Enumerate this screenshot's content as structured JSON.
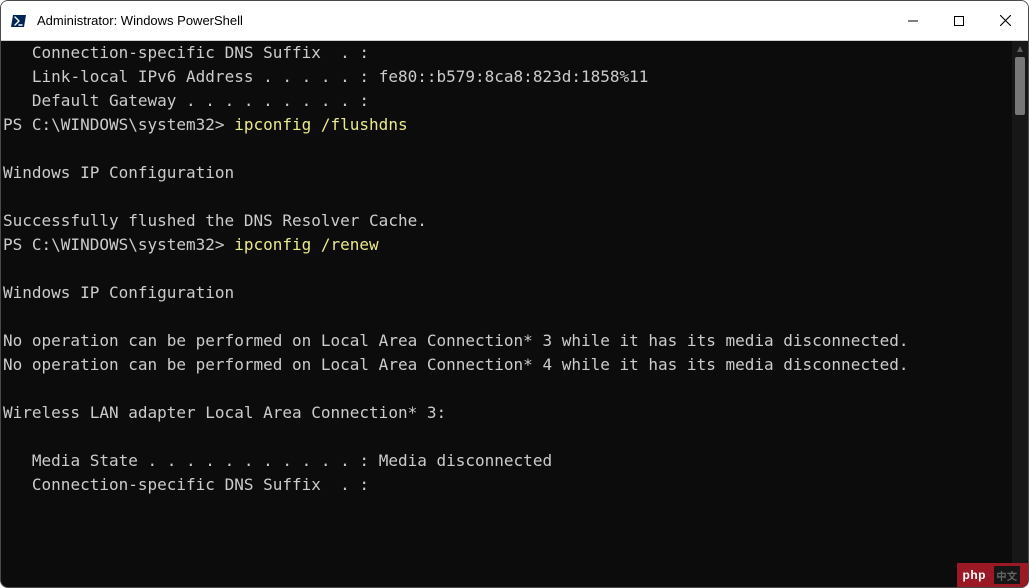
{
  "titlebar": {
    "title": "Administrator: Windows PowerShell"
  },
  "console": {
    "l01": "   Connection-specific DNS Suffix  . :",
    "l02": "   Link-local IPv6 Address . . . . . : fe80::b579:8ca8:823d:1858%11",
    "l03": "   Default Gateway . . . . . . . . . :",
    "p1_prompt": "PS C:\\WINDOWS\\system32> ",
    "p1_cmd": "ipconfig /flushdns",
    "l05": "",
    "l06": "Windows IP Configuration",
    "l07": "",
    "l08": "Successfully flushed the DNS Resolver Cache.",
    "p2_prompt": "PS C:\\WINDOWS\\system32> ",
    "p2_cmd": "ipconfig /renew",
    "l10": "",
    "l11": "Windows IP Configuration",
    "l12": "",
    "l13": "No operation can be performed on Local Area Connection* 3 while it has its media disconnected.",
    "l14": "No operation can be performed on Local Area Connection* 4 while it has its media disconnected.",
    "l15": "",
    "l16": "Wireless LAN adapter Local Area Connection* 3:",
    "l17": "",
    "l18": "   Media State . . . . . . . . . . . : Media disconnected",
    "l19": "   Connection-specific DNS Suffix  . :"
  },
  "badge": {
    "text": "php"
  }
}
